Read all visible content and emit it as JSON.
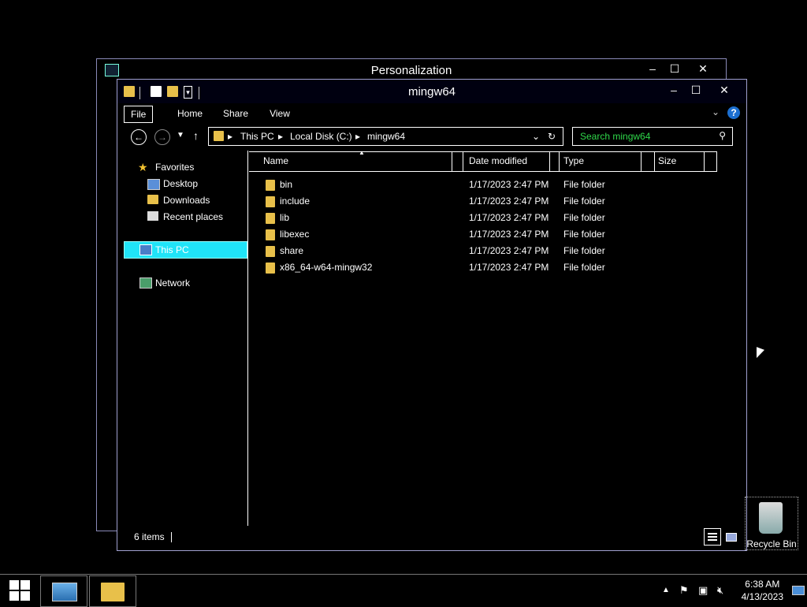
{
  "bg_window": {
    "title": "Personalization"
  },
  "window": {
    "title": "mingw64",
    "controls": {
      "minimize": "–",
      "maximize": "☐",
      "close": "✕"
    }
  },
  "ribbon": {
    "tabs": [
      "File",
      "Home",
      "Share",
      "View"
    ],
    "help": "?"
  },
  "address": {
    "crumbs": [
      "This PC",
      "Local Disk (C:)",
      "mingw64"
    ]
  },
  "search": {
    "placeholder": "Search mingw64"
  },
  "nav": {
    "favorites": "Favorites",
    "desktop": "Desktop",
    "downloads": "Downloads",
    "recent": "Recent places",
    "thispc": "This PC",
    "network": "Network"
  },
  "columns": {
    "name": "Name",
    "date": "Date modified",
    "type": "Type",
    "size": "Size"
  },
  "files": [
    {
      "name": "bin",
      "date": "1/17/2023 2:47 PM",
      "type": "File folder"
    },
    {
      "name": "include",
      "date": "1/17/2023 2:47 PM",
      "type": "File folder"
    },
    {
      "name": "lib",
      "date": "1/17/2023 2:47 PM",
      "type": "File folder"
    },
    {
      "name": "libexec",
      "date": "1/17/2023 2:47 PM",
      "type": "File folder"
    },
    {
      "name": "share",
      "date": "1/17/2023 2:47 PM",
      "type": "File folder"
    },
    {
      "name": "x86_64-w64-mingw32",
      "date": "1/17/2023 2:47 PM",
      "type": "File folder"
    }
  ],
  "status": {
    "items": "6 items"
  },
  "desktop": {
    "recycle_bin": "Recycle Bin"
  },
  "taskbar": {
    "time": "6:38 AM",
    "date": "4/13/2023"
  },
  "colors": {
    "selection": "#20e4f8",
    "search_text": "#2fd84a",
    "folder": "#e8c04a"
  }
}
